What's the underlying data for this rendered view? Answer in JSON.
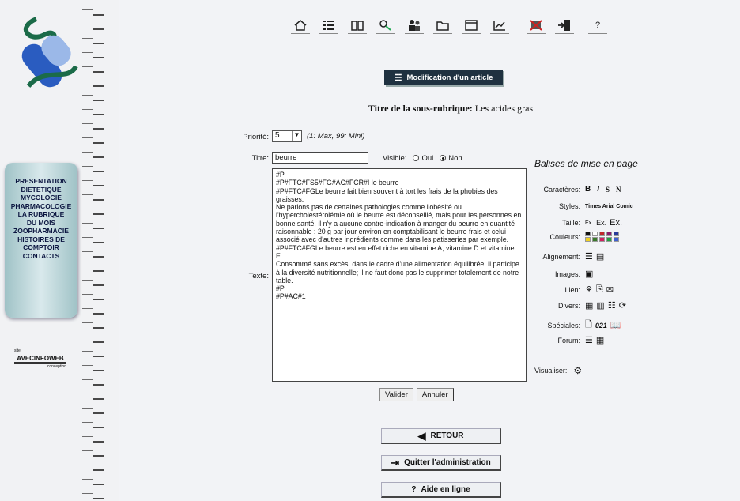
{
  "sidebar": {
    "menu": [
      "PRESENTATION",
      "DIETETIQUE",
      "MYCOLOGIE",
      "PHARMACOLOGIE",
      "LA RUBRIQUE DU MOIS",
      "ZOOPHARMACIE",
      "HISTOIRES DE COMPTOIR",
      "CONTACTS"
    ],
    "partner_small": "site",
    "partner_name": "AVECINFOWEB",
    "partner_sub": "conception"
  },
  "toolbar": {
    "icons": [
      "home-icon",
      "list-icon",
      "book-icon",
      "search-icon",
      "users-icon",
      "folder-icon",
      "window-icon",
      "chart-icon",
      "delete-icon",
      "exit-icon",
      "help-icon"
    ],
    "help": "?"
  },
  "header": {
    "mod_title": "Modification d'un article",
    "subtitle_label": "Titre de la sous-rubrique:",
    "subtitle_value": "Les acides gras"
  },
  "form": {
    "priorite_label": "Priorité:",
    "priorite_value": "5",
    "priorite_hint": "(1: Max, 99: Mini)",
    "titre_label": "Titre:",
    "titre_value": "beurre",
    "visible_label": "Visible:",
    "oui": "Oui",
    "non": "Non",
    "visible_selected": "Non",
    "texte_label": "Texte:",
    "texte_value": "#P\n#P#FTC#FS5#FG#AC#FCR#I le beurre\n#P#FTC#FGLe beurre fait bien souvent à tort les frais de la phobies des graisses.\nNe parlons pas de certaines pathologies comme l'obésité ou l'hypercholestérolémie où le beurre est déconseillé, mais pour les personnes en bonne santé, il n'y a aucune contre-indication à manger du beurre en quantité raisonnable : 20 g par jour environ en comptabilisant le beurre frais et celui associé avec d'autres ingrédients comme dans les patisseries par exemple.\n#P#FTC#FGLe beurre est en effet riche en vitamine A, vitamine D et vitamine E.\nConsommé sans excès, dans le cadre d'une alimentation équilibrée, il participe à la diversité nutritionnelle; il ne faut donc pas le supprimer totalement de notre table.\n#P\n#P#AC#1",
    "valider": "Valider",
    "annuler": "Annuler"
  },
  "palette": {
    "title": "Balises de mise en page",
    "caracteres_label": "Caractères:",
    "caracteres": [
      "B",
      "I",
      "S",
      "N"
    ],
    "styles_label": "Styles:",
    "styles": "Times Arial Comic",
    "taille_label": "Taille:",
    "taille": [
      "Ex.",
      "Ex.",
      "Ex."
    ],
    "couleurs_label": "Couleurs:",
    "colors": [
      "#111111",
      "#ffffff",
      "#c0262b",
      "#8a1a6c",
      "#2a3b9a",
      "#f0d020",
      "#3a7a2a",
      "#d02060",
      "#20a040",
      "#4060d0"
    ],
    "alignement_label": "Alignement:",
    "images_label": "Images:",
    "liens_label": "Lien:",
    "divers_label": "Divers:",
    "speciales_label": "Spéciales:",
    "speciales_text": "021",
    "forum_label": "Forum:",
    "visualiser_label": "Visualiser:"
  },
  "nav": {
    "retour": "RETOUR",
    "quitter": "Quitter l'administration",
    "aide": "Aide en ligne",
    "aide_icon": "?"
  }
}
